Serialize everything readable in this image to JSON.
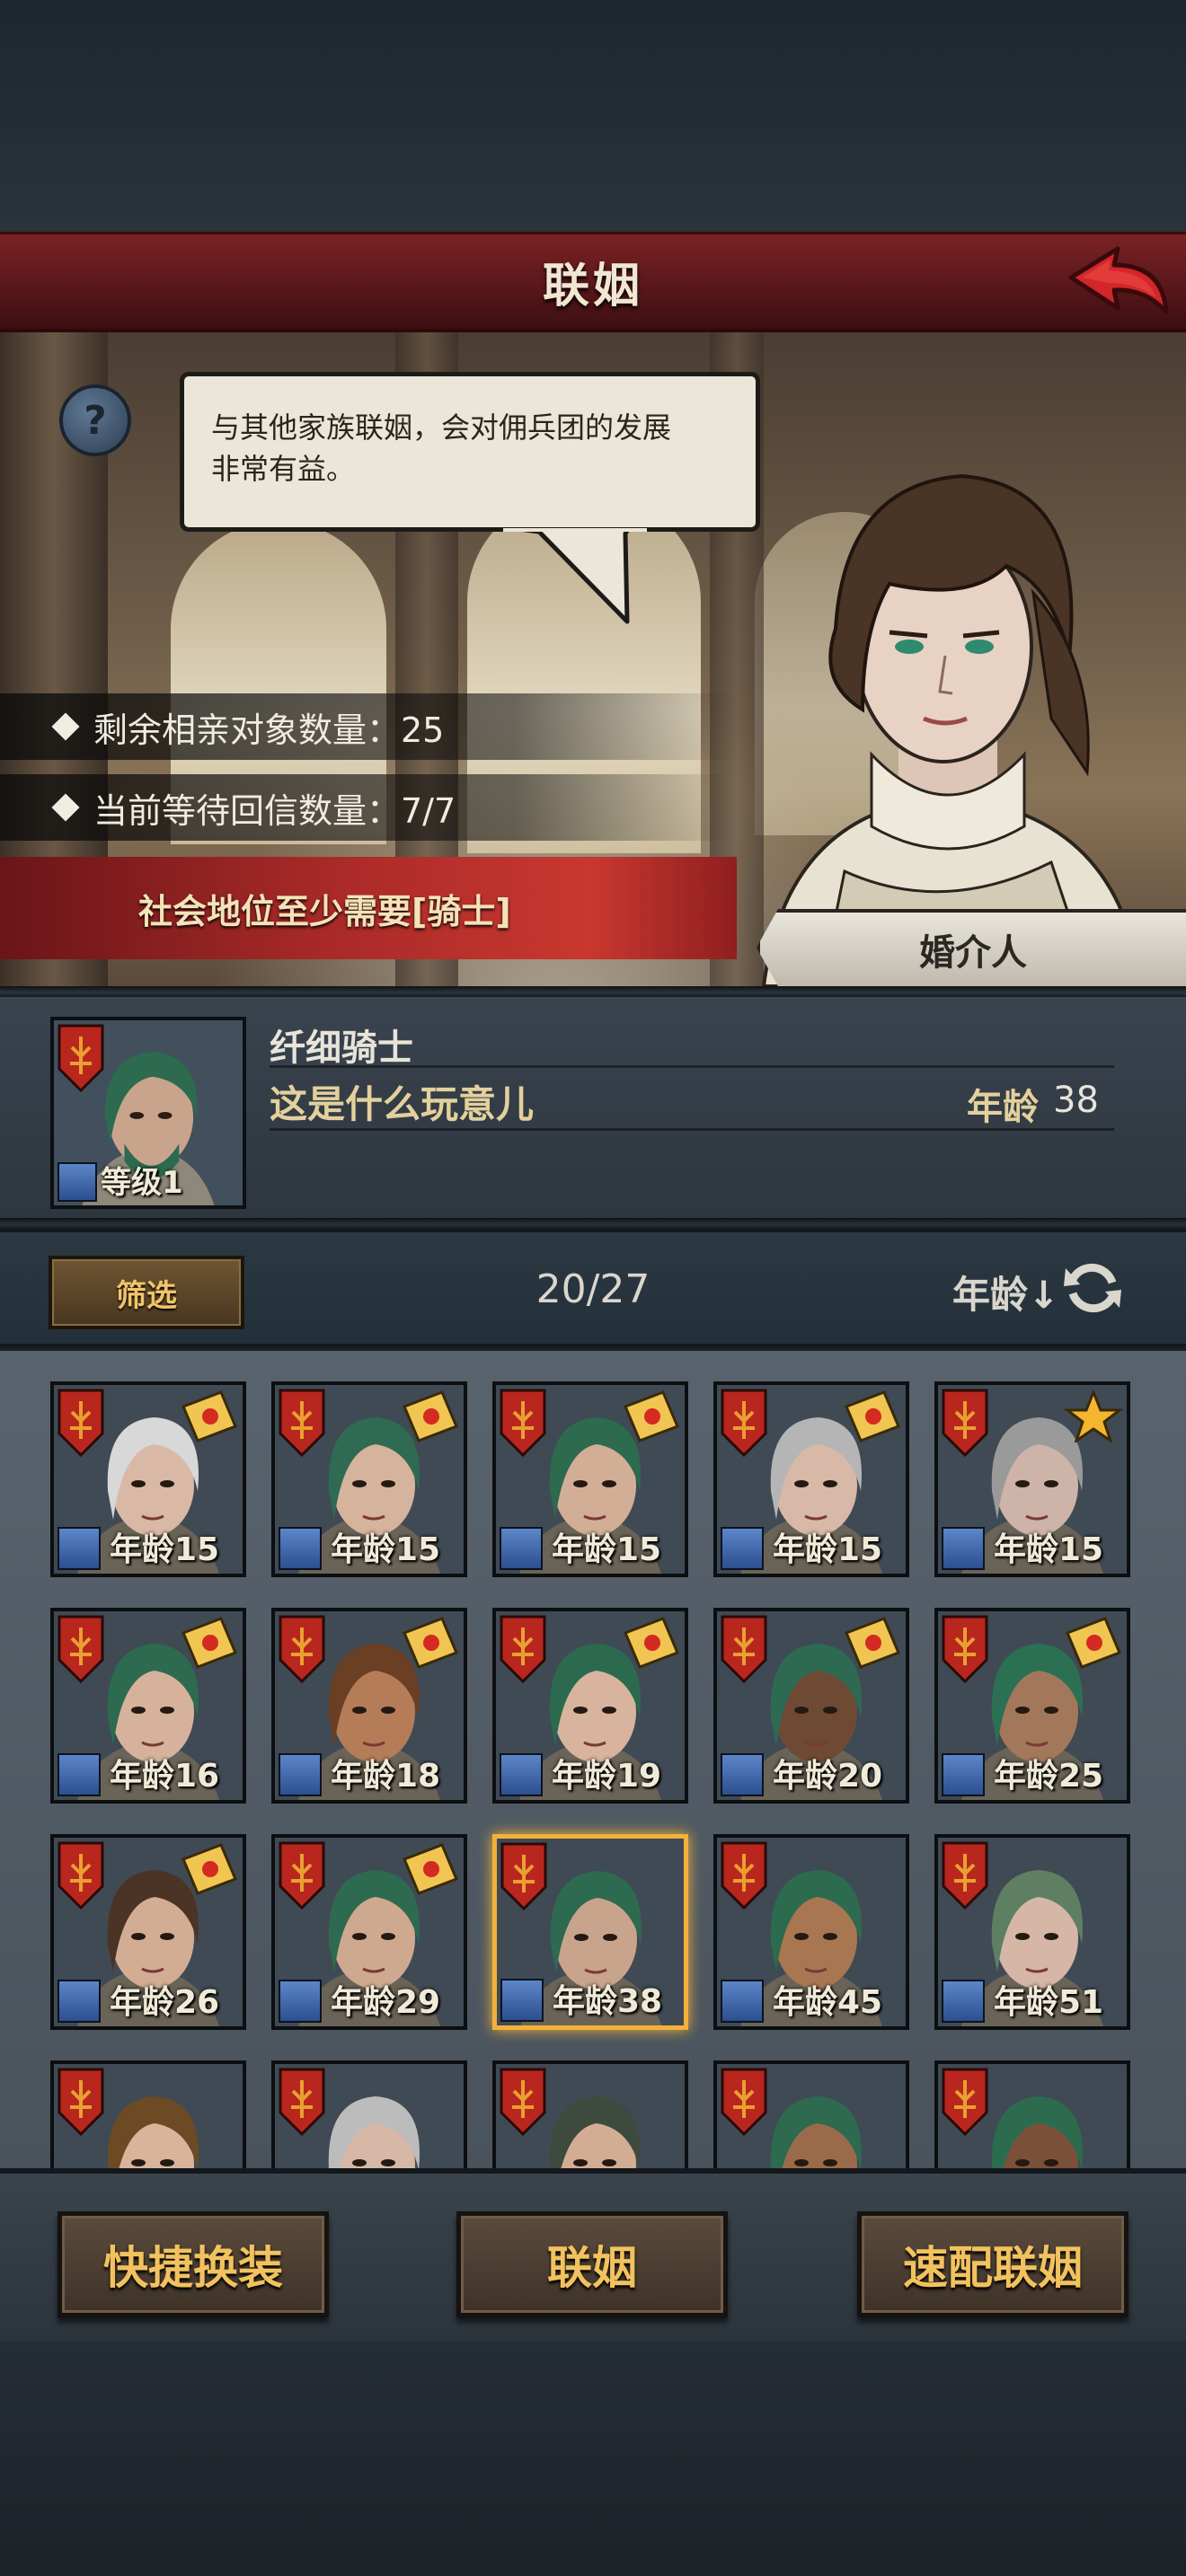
{
  "header": {
    "title": "联姻",
    "back_icon": "back-arrow-icon"
  },
  "scene": {
    "help_label": "?",
    "dialogue": [
      "与其他家族联姻，会对佣兵团的发展",
      "非常有益。"
    ],
    "stats": [
      "剩余相亲对象数量：25",
      "当前等待回信数量：7/7"
    ],
    "requirement": "社会地位至少需要[骑士]",
    "npc_role": "婚介人"
  },
  "selected": {
    "name": "纤细骑士",
    "title": "这是什么玩意儿",
    "age_label": "年龄",
    "age": "38",
    "level": "等级1"
  },
  "filter": {
    "button": "筛选",
    "count": "20/27",
    "sort_label": "年龄↓",
    "sort_icon": "refresh-icon"
  },
  "candidates": [
    {
      "age": "年龄15",
      "badge": "letter",
      "hair": "#d8d8d8",
      "skin": "#d9b9a6",
      "selected": false
    },
    {
      "age": "年龄15",
      "badge": "letter",
      "hair": "#2f6b52",
      "skin": "#d6b39c",
      "selected": false
    },
    {
      "age": "年龄15",
      "badge": "letter",
      "hair": "#2d6a4e",
      "skin": "#d2ae96",
      "selected": false
    },
    {
      "age": "年龄15",
      "badge": "letter",
      "hair": "#b5b5b5",
      "skin": "#d8b8a6",
      "selected": false
    },
    {
      "age": "年龄15",
      "badge": "star",
      "hair": "#9a9a9a",
      "skin": "#cdb3a8",
      "selected": false
    },
    {
      "age": "年龄16",
      "badge": "letter",
      "hair": "#2e6a50",
      "skin": "#d6b29c",
      "selected": false
    },
    {
      "age": "年龄18",
      "badge": "letter",
      "hair": "#6b3f24",
      "skin": "#b57c58",
      "selected": false
    },
    {
      "age": "年龄19",
      "badge": "letter",
      "hair": "#2b6a4e",
      "skin": "#d8b49e",
      "selected": false
    },
    {
      "age": "年龄20",
      "badge": "letter",
      "hair": "#2e6a52",
      "skin": "#6e4a34",
      "selected": false
    },
    {
      "age": "年龄25",
      "badge": "letter",
      "hair": "#2c7054",
      "skin": "#a3785a",
      "selected": false
    },
    {
      "age": "年龄26",
      "badge": "letter",
      "hair": "#4b3426",
      "skin": "#d2ad94",
      "selected": false
    },
    {
      "age": "年龄29",
      "badge": "letter",
      "hair": "#2e6a50",
      "skin": "#cfa98f",
      "selected": false
    },
    {
      "age": "年龄38",
      "badge": "none",
      "hair": "#2e6a50",
      "skin": "#c9a48c",
      "selected": true
    },
    {
      "age": "年龄45",
      "badge": "none",
      "hair": "#2c6b4e",
      "skin": "#a87752",
      "selected": false
    },
    {
      "age": "年龄51",
      "badge": "none",
      "hair": "#5f7f62",
      "skin": "#d6b6a6",
      "selected": false
    },
    {
      "age": "",
      "badge": "none",
      "hair": "#6b4a24",
      "skin": "#d8b49a",
      "selected": false
    },
    {
      "age": "",
      "badge": "none",
      "hair": "#bcbcbc",
      "skin": "#d7b8a6",
      "selected": false
    },
    {
      "age": "",
      "badge": "none",
      "hair": "#3f4a3e",
      "skin": "#d2ad94",
      "selected": false
    },
    {
      "age": "",
      "badge": "none",
      "hair": "#2d6a50",
      "skin": "#9a6a4a",
      "selected": false
    },
    {
      "age": "",
      "badge": "none",
      "hair": "#2c6b4e",
      "skin": "#7a5038",
      "selected": false
    }
  ],
  "actions": {
    "quick_outfit": "快捷换装",
    "marry": "联姻",
    "quick_match": "速配联姻"
  },
  "colors": {
    "accent_gold": "#f2c25e",
    "title_red": "#7a2225",
    "selected_border": "#f3b13a"
  }
}
